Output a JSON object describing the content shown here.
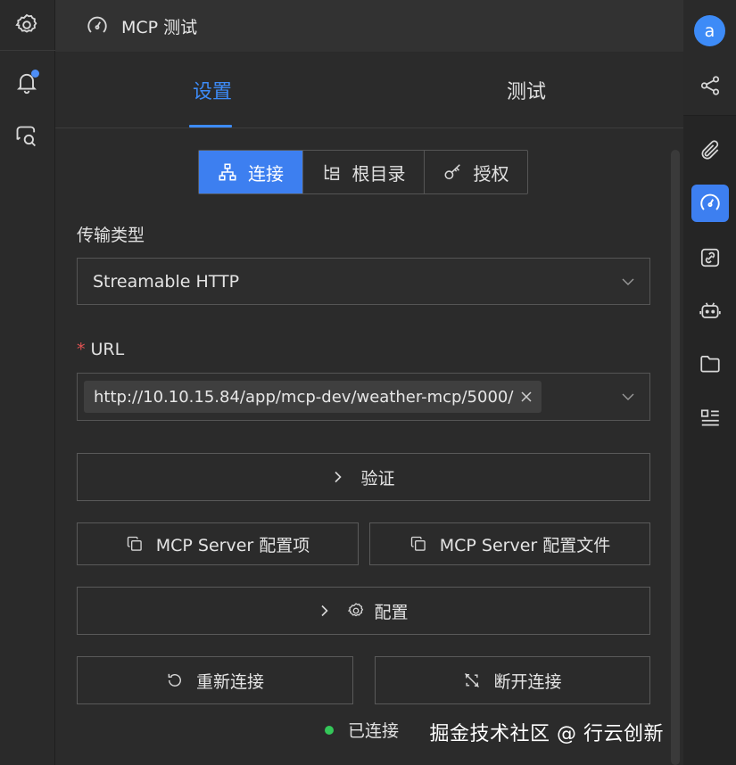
{
  "header": {
    "title": "MCP 测试",
    "icon": "gauge-icon"
  },
  "tabs": [
    {
      "label": "设置",
      "active": true
    },
    {
      "label": "测试",
      "active": false
    }
  ],
  "segments": [
    {
      "label": "连接",
      "icon": "network-icon",
      "active": true
    },
    {
      "label": "根目录",
      "icon": "tree-icon",
      "active": false
    },
    {
      "label": "授权",
      "icon": "key-icon",
      "active": false
    }
  ],
  "form": {
    "transport_label": "传输类型",
    "transport_value": "Streamable HTTP",
    "url_label": "URL",
    "url_required_mark": "*",
    "url_value": "http://10.10.15.84/app/mcp-dev/weather-mcp/5000/"
  },
  "buttons": {
    "verify": "验证",
    "server_config_item": "MCP Server 配置项",
    "server_config_file": "MCP Server 配置文件",
    "config": "配置",
    "reconnect": "重新连接",
    "disconnect": "断开连接"
  },
  "status": {
    "text": "已连接",
    "color": "#34c759"
  },
  "watermark": "掘金技术社区 @ 行云创新",
  "avatar": {
    "letter": "a"
  },
  "colors": {
    "accent": "#3d8bf7",
    "background": "#2b2b2b",
    "notification": "#4d8ef7"
  },
  "left_sidebar": [
    "gear-icon",
    "bell-icon",
    "chat-search-icon"
  ],
  "right_sidebar": [
    "share-icon",
    "paperclip-icon",
    "gauge-icon",
    "link-icon",
    "robot-icon",
    "folder-icon",
    "list-icon"
  ]
}
